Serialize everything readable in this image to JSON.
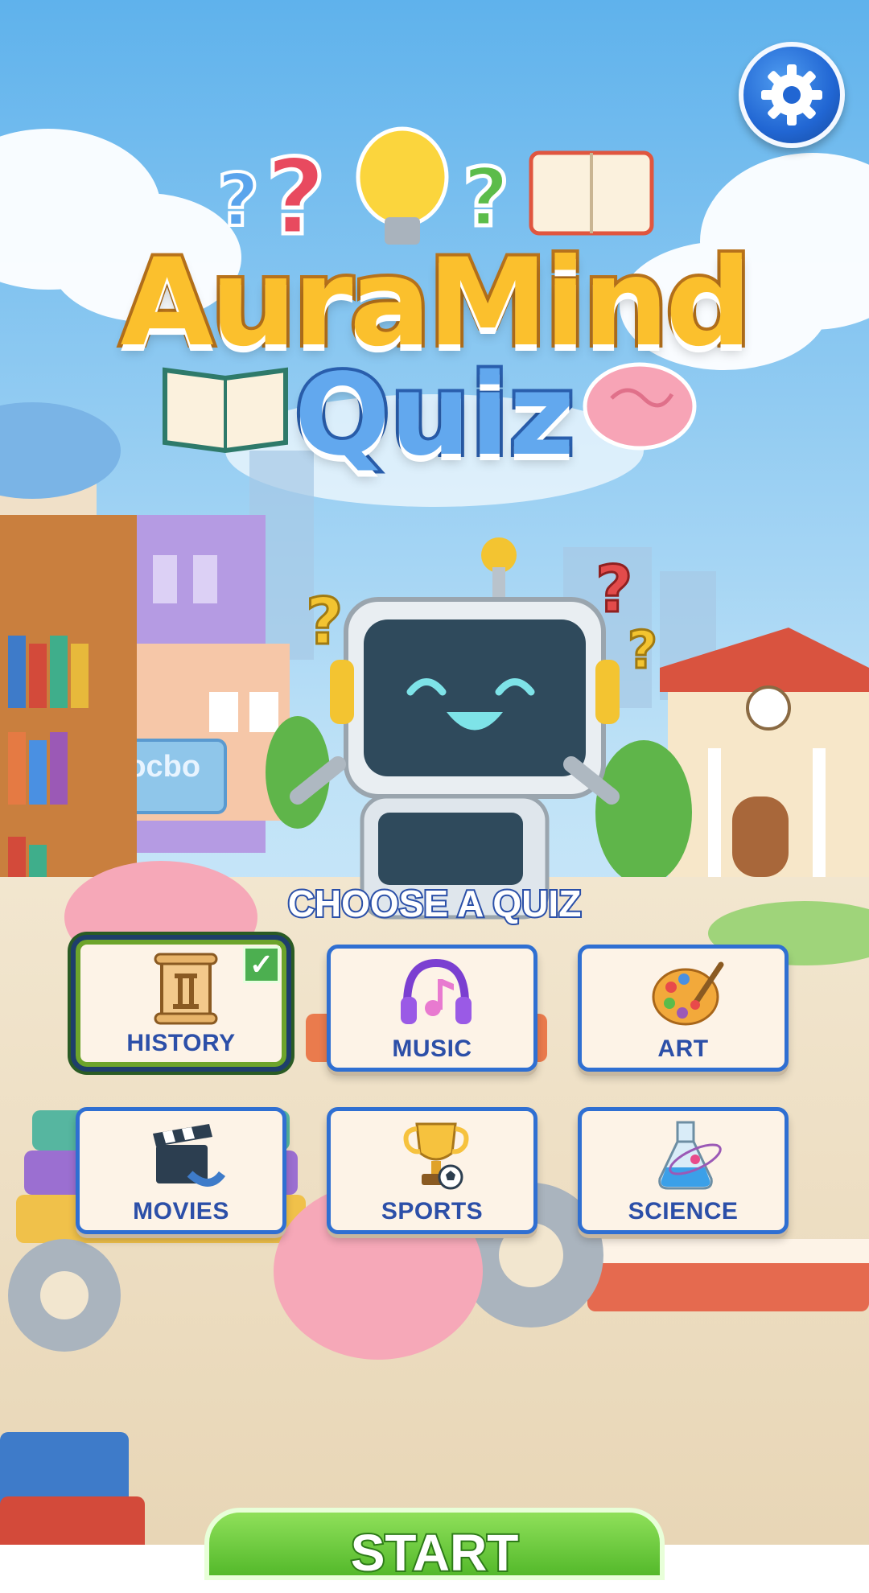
{
  "app": {
    "title_line1": "AuraMind",
    "title_line2": "Quiz"
  },
  "scene": {
    "sign_text": "Cocbo"
  },
  "header": {
    "settings_icon": "gear-icon"
  },
  "quiz_select": {
    "heading": "CHOOSE A QUIZ",
    "selected": "HISTORY",
    "categories": [
      {
        "label": "HISTORY",
        "icon": "scroll-icon",
        "selected": true
      },
      {
        "label": "MUSIC",
        "icon": "headphones-icon",
        "selected": false
      },
      {
        "label": "ART",
        "icon": "palette-icon",
        "selected": false
      },
      {
        "label": "MOVIES",
        "icon": "clapperboard-icon",
        "selected": false
      },
      {
        "label": "SPORTS",
        "icon": "trophy-icon",
        "selected": false
      },
      {
        "label": "SCIENCE",
        "icon": "flask-icon",
        "selected": false
      }
    ]
  },
  "start_button": {
    "label": "START"
  },
  "colors": {
    "accent": "#2f6fd2",
    "title_yellow": "#fbc02d",
    "title_blue": "#62a8ee",
    "start_green": "#54b92b",
    "selected_green": "#6da42b"
  }
}
